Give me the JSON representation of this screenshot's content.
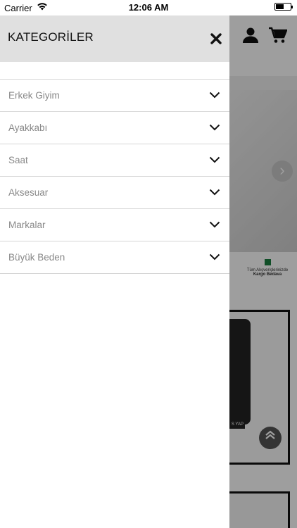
{
  "status_bar": {
    "carrier": "Carrier",
    "time": "12:06 AM"
  },
  "drawer": {
    "title": "KATEGORİLER",
    "close_icon": "close-icon",
    "categories": [
      {
        "label": "Erkek Giyim"
      },
      {
        "label": "Ayakkabı"
      },
      {
        "label": "Saat"
      },
      {
        "label": "Aksesuar"
      },
      {
        "label": "Markalar"
      },
      {
        "label": "Büyük Beden"
      }
    ]
  },
  "background": {
    "cargo_line1": "Tüm Alışverişlerinizde",
    "cargo_line2": "Kargo Bedava",
    "product_button": "S YAP"
  },
  "colors": {
    "drawer_header": "#e0e0e0",
    "overlay": "#000000",
    "category_text": "#888888"
  }
}
